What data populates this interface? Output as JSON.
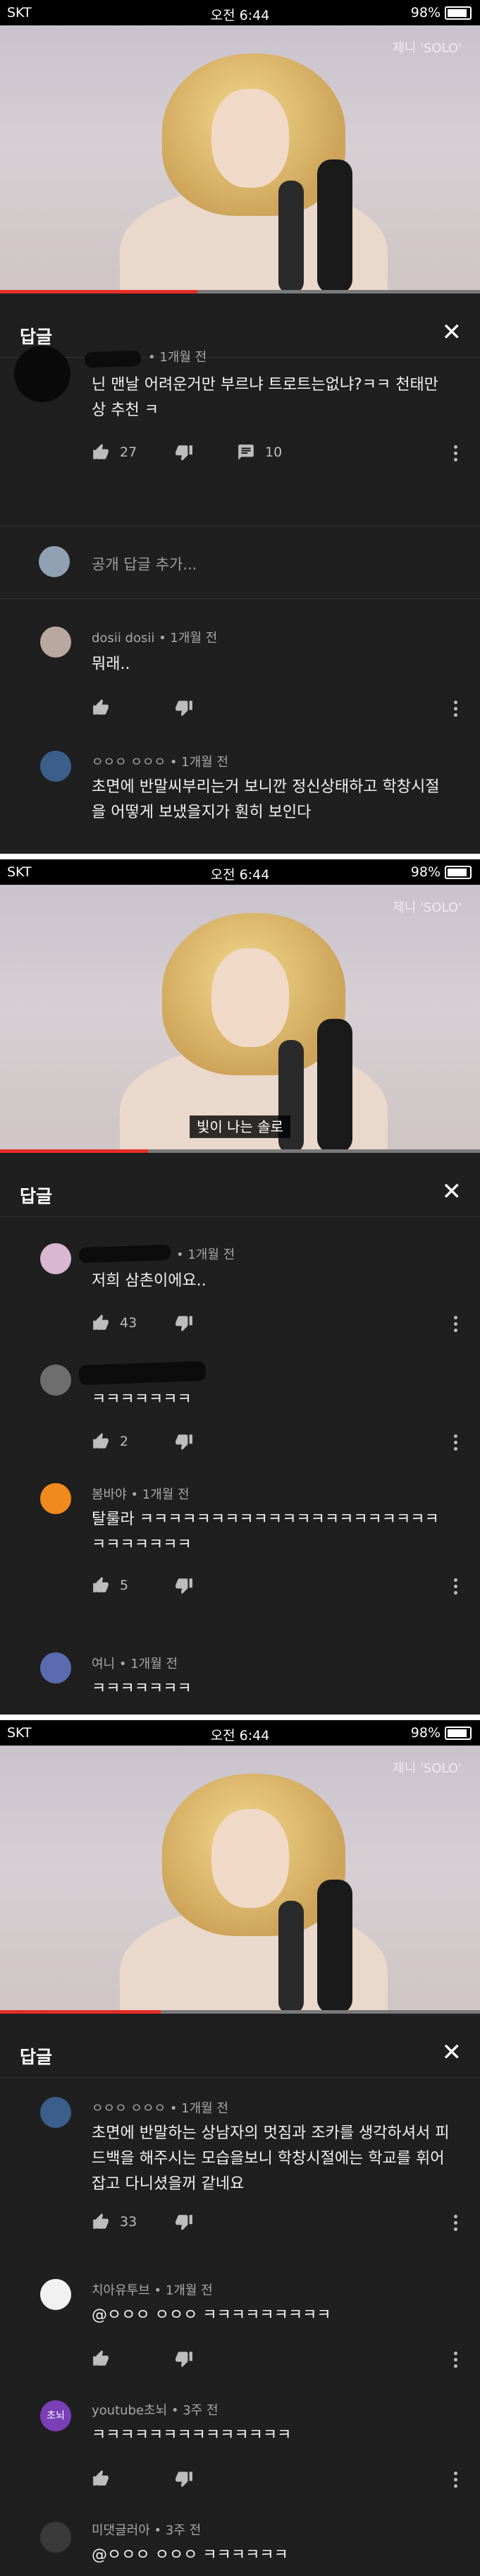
{
  "status_bar": {
    "carrier": "SKT",
    "time": "오전 6:44",
    "battery": "98%"
  },
  "video": {
    "watermark": "제니 'SOLO'",
    "subtitle_panel2": "빛이 나는 솔로"
  },
  "sheet": {
    "title": "답글"
  },
  "panel1": {
    "main_comment": {
      "date": "• 1개월 전",
      "text": "닌 맨날 어려운거만 부르냐 트로트는없냐?ㅋㅋ 천태만상 추천 ㅋ",
      "likes": "27",
      "replies": "10"
    },
    "add_reply_placeholder": "공개 답글 추가...",
    "reply1": {
      "author": "dosii dosii",
      "date": "• 1개월 전",
      "text": "뭐래.."
    },
    "reply2": {
      "author": "ㅇㅇㅇ ㅇㅇㅇ",
      "date": "• 1개월 전",
      "text": "초면에 반말씨부리는거 보니깐 정신상태하고 학창시절을 어떻게 보냈을지가 훤히 보인다"
    }
  },
  "panel2": {
    "reply1": {
      "date": "• 1개월 전",
      "text": "저희 삼촌이에요..",
      "likes": "43"
    },
    "reply2": {
      "text": "ㅋㅋㅋㅋㅋㅋㅋ",
      "likes": "2"
    },
    "reply3": {
      "author": "봄바야",
      "date": "• 1개월 전",
      "text": "탈룰라 ㅋㅋㅋㅋㅋㅋㅋㅋㅋㅋㅋㅋㅋㅋㅋㅋㅋㅋㅋㅋㅋㅋㅋㅋㅋㅋㅋㅋ",
      "likes": "5"
    },
    "reply4": {
      "author": "여니",
      "date": "• 1개월 전",
      "text": "ㅋㅋㅋㅋㅋㅋㅋ"
    }
  },
  "panel3": {
    "reply1": {
      "author": "ㅇㅇㅇ ㅇㅇㅇ",
      "date": "• 1개월 전",
      "text": "초면에 반말하는 상남자의 멋짐과 조카를 생각하셔서 피드백을 해주시는 모습을보니 학창시절에는 학교를 휘어잡고 다니셨을꺼 같네요",
      "likes": "33"
    },
    "reply2": {
      "author": "치아유투브",
      "date": "• 1개월 전",
      "text": "@ㅇㅇㅇ ㅇㅇㅇ ㅋㅋㅋㅋㅋㅋㅋㅋㅋ"
    },
    "reply3": {
      "author": "youtube초뇌",
      "date": "• 3주 전",
      "text": "ㅋㅋㅋㅋㅋㅋㅋㅋㅋㅋㅋㅋㅋㅋ",
      "avatar_text": "초뇌"
    },
    "reply4": {
      "author": "미댓글러아",
      "date": "• 3주 전",
      "text": "@ㅇㅇㅇ ㅇㅇㅇ ㅋㅋㅋㅋㅋㅋ"
    }
  }
}
